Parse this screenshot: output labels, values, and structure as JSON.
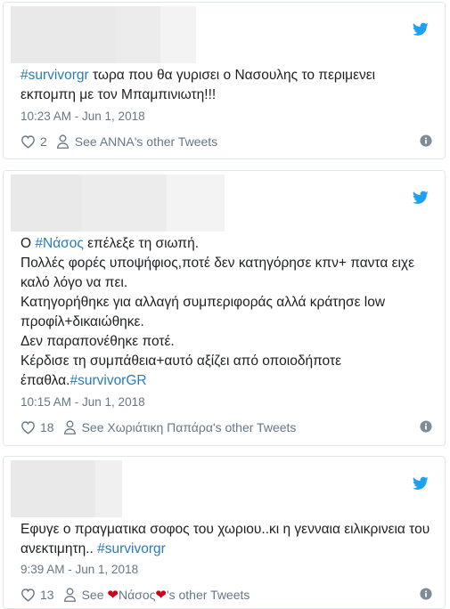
{
  "tweets": [
    {
      "hashtag_lead": "#survivorgr",
      "text_after": " τωρα που θα γυρισει ο Νασουλης το περιμενει εκπομπη με τον Μπαμπινιωτη!!!",
      "timestamp": "10:23 AM - Jun 1, 2018",
      "likes": "2",
      "see_label": "See ANNA's other Tweets"
    },
    {
      "line1_pre": "Ο ",
      "line1_tag": "#Νάσος",
      "line1_post": " επέλεξε τη σιωπή.",
      "line2": "Πολλές φορές υποψήφιος,ποτέ δεν κατηγόρησε κπν+ παντα ειχε καλό λόγο να πει.",
      "line3": "Κατηγορήθηκε για αλλαγή συμπεριφοράς αλλά κράτησε low προφίλ+δικαιώθηκε.",
      "line4": "Δεν παραπονέθηκε ποτέ.",
      "line5_pre": "Κέρδισε τη συμπάθεια+αυτό αξίζει από οποιοδήποτε έπαθλα.",
      "line5_tag": "#survivorGR",
      "timestamp": "10:15 AM - Jun 1, 2018",
      "likes": "18",
      "see_label": "See Χωριάτικη Παπάρα's other Tweets"
    },
    {
      "text": "Εφυγε ο πραγματικα σοφος του χωριου..κι η γενναια ειλικρινεια του  ανεκτιμητη.. ",
      "hashtag_tail": "#survivorgr",
      "timestamp": "9:39 AM - Jun 1, 2018",
      "likes": "13",
      "see_pre": "See ",
      "see_name": "Νάσος",
      "see_post": "'s other Tweets",
      "heart_glyph": "❤"
    }
  ],
  "colors": {
    "link": "#2b7bb9",
    "muted": "#657786",
    "twitter_blue": "#1da1f2",
    "heart_red": "#d0021b"
  },
  "icons": [
    "twitter-bird-icon",
    "heart-icon",
    "person-icon",
    "info-icon"
  ]
}
